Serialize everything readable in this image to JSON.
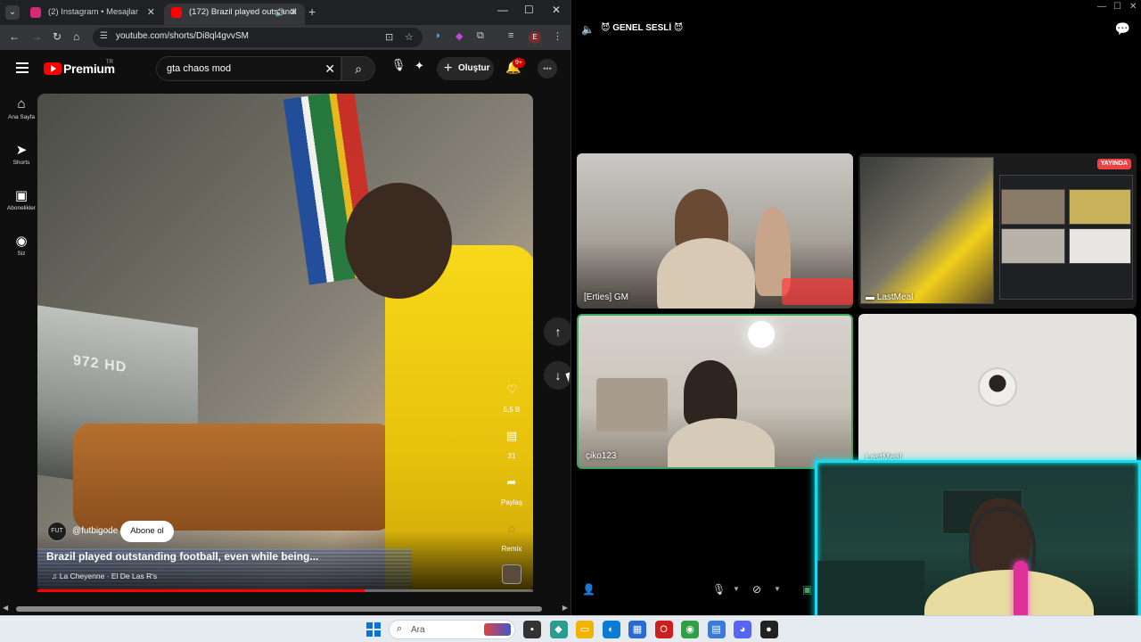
{
  "browser": {
    "tabs": [
      {
        "label": "(2) Instagram • Mesajlar",
        "favicon_color": "#d62976"
      },
      {
        "label": "(172) Brazil played outstandi",
        "favicon_color": "#ff0000"
      }
    ],
    "url": "youtube.com/shorts/Di8ql4gvvSM",
    "profile_initial": "E"
  },
  "youtube": {
    "brand": "Premium",
    "region": "TR",
    "search_query": "gta chaos mod",
    "create_label": "Oluştur",
    "notification_count": "9+",
    "sidebar": [
      {
        "icon": "home-icon",
        "glyph": "⌂",
        "label": "Ana Sayfa"
      },
      {
        "icon": "shorts-icon",
        "glyph": "➤",
        "label": "Shorts"
      },
      {
        "icon": "subscriptions-icon",
        "glyph": "▣",
        "label": "Abonelikler"
      },
      {
        "icon": "you-icon",
        "glyph": "◉",
        "label": "Siz"
      }
    ],
    "short": {
      "channel": "@futbigode",
      "subscribe_label": "Abone ol",
      "title": "Brazil played outstanding football, even while being...",
      "music": "♫ La Cheyenne · El De Las R's",
      "likes": "5,5 B",
      "comments": "31",
      "share_label": "Paylaş",
      "remix_label": "Remix",
      "camera_text": "972 HD",
      "progress": 0.66
    }
  },
  "discord": {
    "channel_title": "😈 GENEL SESLİ 😈",
    "participants": [
      {
        "name": "[Erties] GM"
      },
      {
        "name": "LastMeal",
        "live_badge": "YAYINDA"
      },
      {
        "name": "çiko123",
        "speaking": true
      },
      {
        "name": "LastMeal"
      }
    ]
  },
  "taskbar": {
    "search_placeholder": "Ara",
    "apps": [
      {
        "icon": "terminal-icon",
        "color": "#333"
      },
      {
        "icon": "copilot-icon",
        "color": "#2a9d8f"
      },
      {
        "icon": "file-explorer-icon",
        "color": "#f0b400"
      },
      {
        "icon": "edge-icon",
        "color": "#0c7bd6"
      },
      {
        "icon": "store-icon",
        "color": "#2a6bd0"
      },
      {
        "icon": "opera-icon",
        "color": "#cc1f1f"
      },
      {
        "icon": "chrome-icon",
        "color": "#2f9e44"
      },
      {
        "icon": "app-icon",
        "color": "#3a7bd5"
      },
      {
        "icon": "discord-icon",
        "color": "#5865f2"
      },
      {
        "icon": "steam-icon",
        "color": "#222"
      }
    ]
  }
}
